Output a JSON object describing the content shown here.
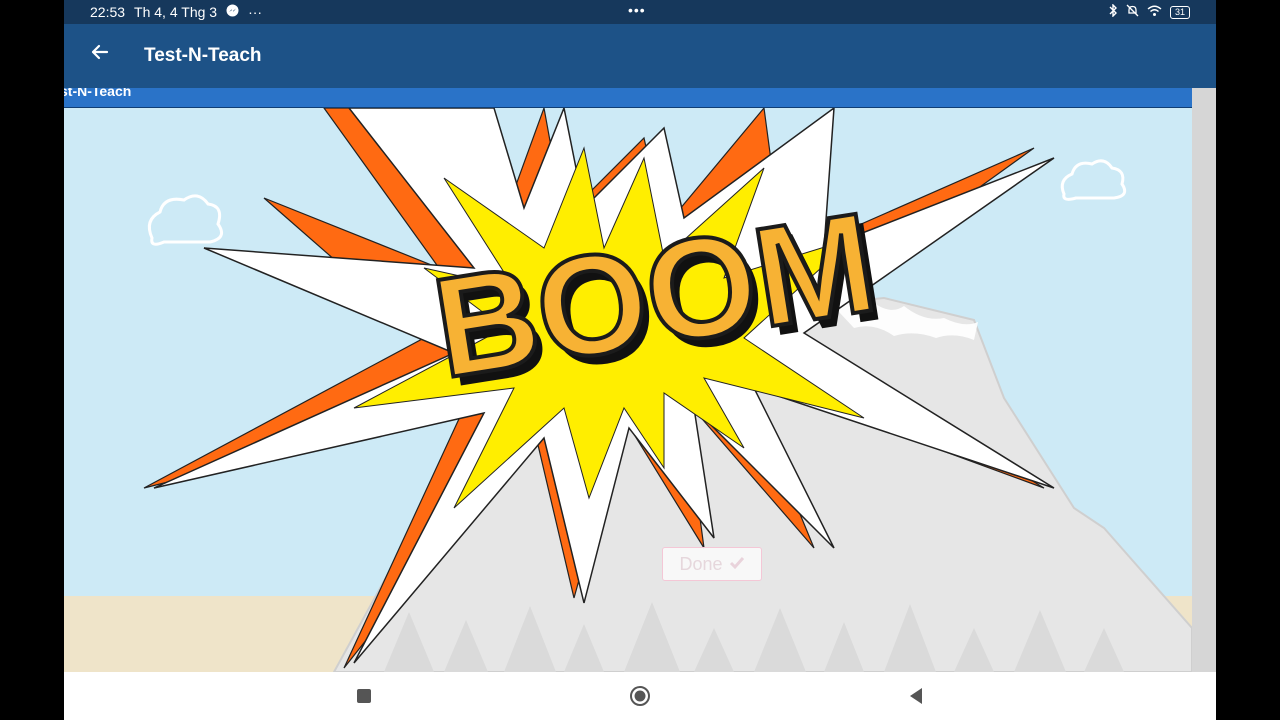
{
  "status_bar": {
    "time": "22:53",
    "date": "Th 4, 4 Thg 3",
    "messenger_icon": "messenger-icon",
    "more": "···",
    "center_dots": "•••",
    "battery": "31"
  },
  "app_bar": {
    "back_icon": "arrow-left-icon",
    "title": "Test-N-Teach"
  },
  "web_header": {
    "title": "st-N-Teach"
  },
  "scene": {
    "boom_text": "BOOM",
    "done_label": "Done",
    "done_icon": "check-icon"
  },
  "nav_bar": {
    "recents_icon": "square-icon",
    "home_icon": "circle-icon",
    "back_icon": "triangle-back-icon"
  },
  "colors": {
    "status_bar": "#16385c",
    "app_bar": "#1d5287",
    "web_header": "#2a73c8",
    "sky": "#cdeaf6",
    "ground": "#efe4c9",
    "orange": "#ff6a12",
    "yellow": "#ffee00",
    "boom_fill": "#f7b234"
  }
}
